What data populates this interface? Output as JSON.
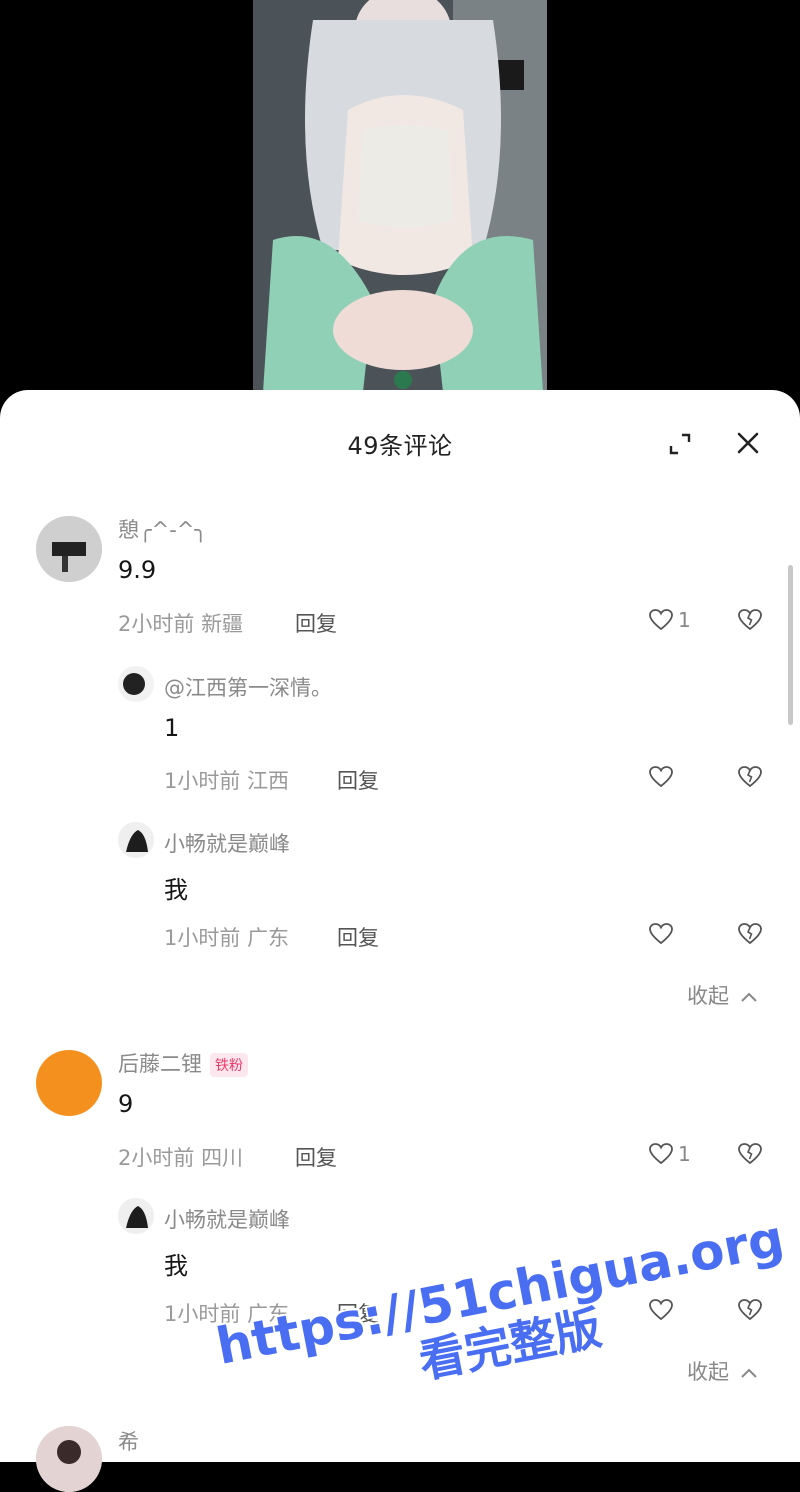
{
  "header": {
    "title": "49条评论",
    "expand_icon": "expand-icon",
    "close_icon": "close-icon"
  },
  "colors": {
    "badge_text": "#ea3a6a",
    "badge_bg": "#fde7ee",
    "watermark": "#4a6ef2"
  },
  "comments": [
    {
      "name": "憩╭^-^╮",
      "text": "9.9",
      "time": "2小时前",
      "location": "新疆",
      "reply_label": "回复",
      "likes": "1",
      "replies": [
        {
          "name": "@江西第一深情。",
          "text": "1",
          "time": "1小时前",
          "location": "江西",
          "reply_label": "回复"
        },
        {
          "name": "小畅就是巅峰",
          "text": "我",
          "time": "1小时前",
          "location": "广东",
          "reply_label": "回复"
        }
      ],
      "collapse_label": "收起"
    },
    {
      "name": "后藤二锂",
      "badge": "铁粉",
      "text": "9",
      "time": "2小时前",
      "location": "四川",
      "reply_label": "回复",
      "likes": "1",
      "replies": [
        {
          "name": "小畅就是巅峰",
          "text": "我",
          "time": "1小时前",
          "location": "广东",
          "reply_label": "回复"
        }
      ],
      "collapse_label": "收起"
    },
    {
      "name": "希"
    }
  ],
  "watermark": {
    "line1": "https://51chigua.org",
    "line2": "看完整版"
  }
}
